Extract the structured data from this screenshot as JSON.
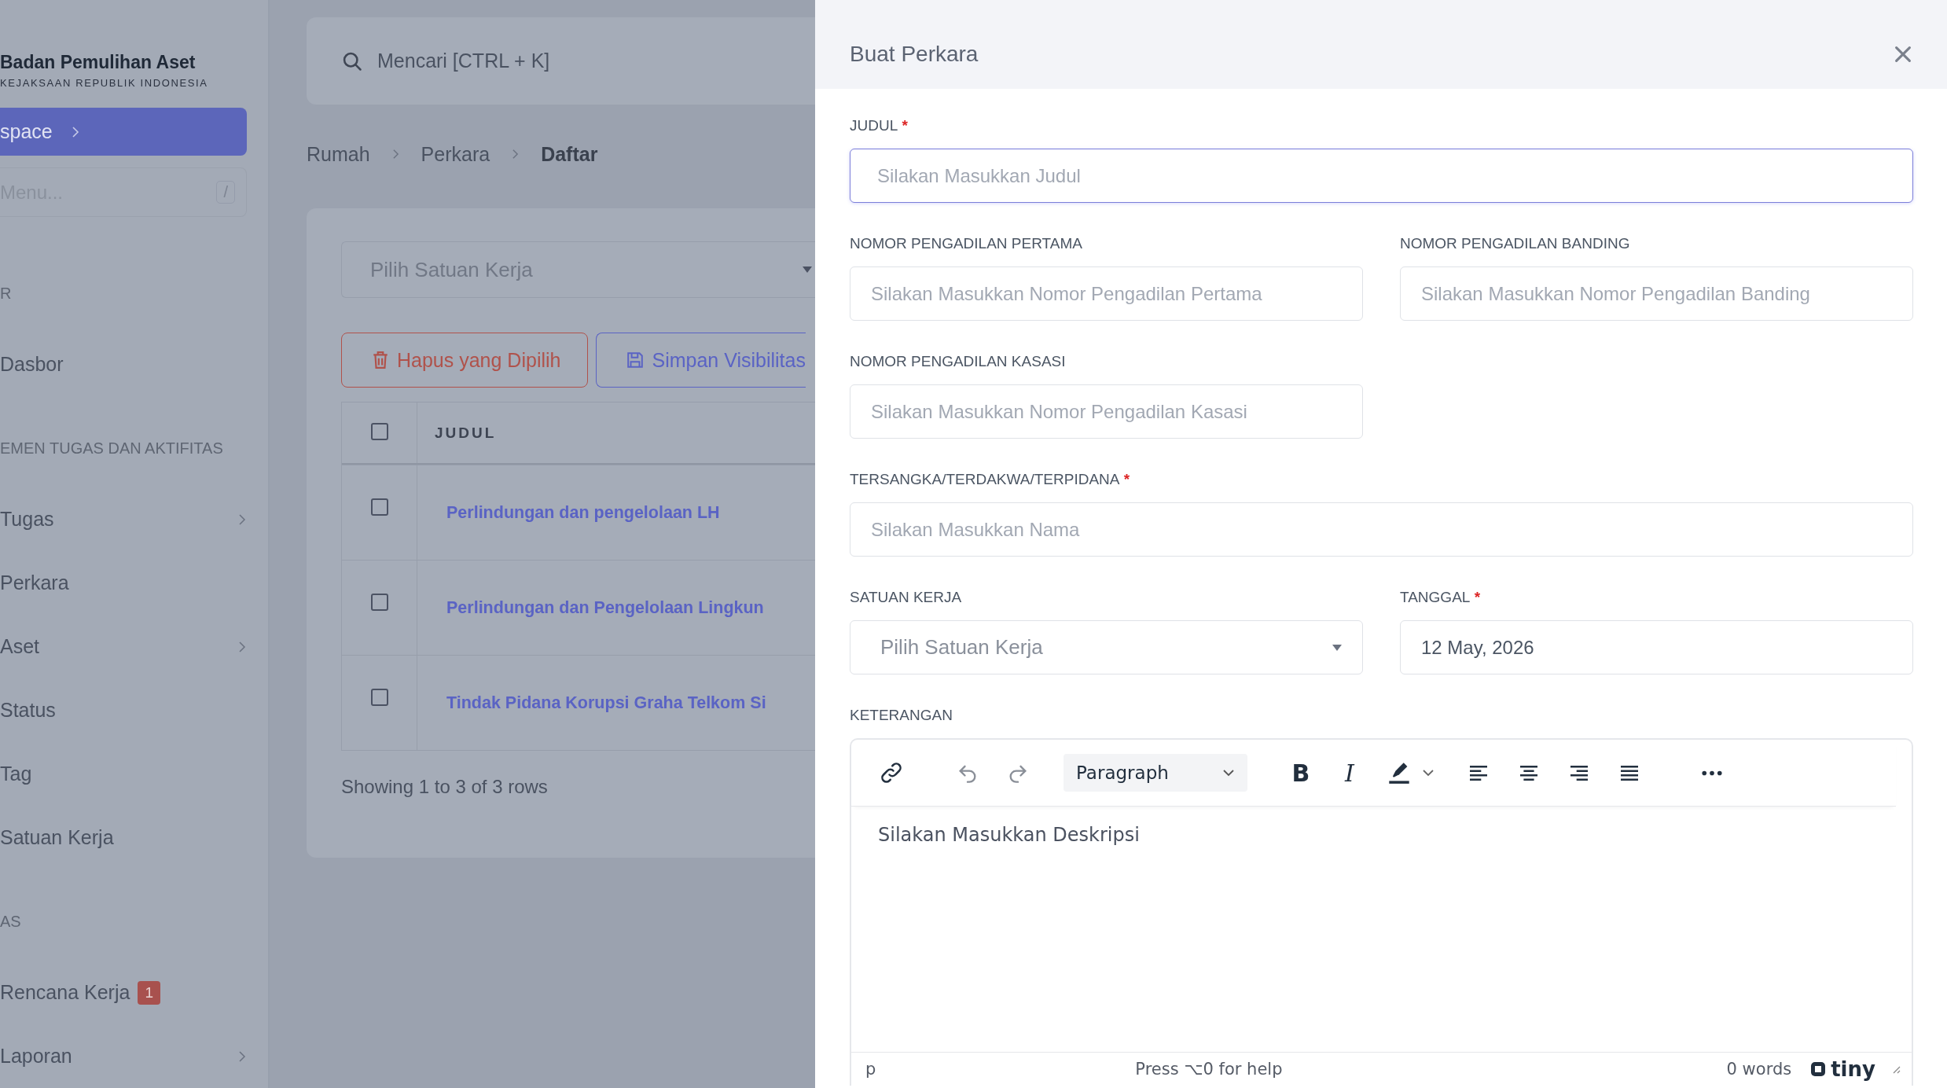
{
  "sidebar": {
    "brand_title": "Badan Pemulihan Aset",
    "brand_subtitle": "KEJAKSAAN REPUBLIK INDONESIA",
    "workspace_button": "space",
    "menu_search": {
      "placeholder": "Menu...",
      "shortcut": "/"
    },
    "sections": [
      {
        "heading": "R",
        "items": [
          {
            "label": "Dasbor",
            "has_submenu": false
          }
        ]
      },
      {
        "heading": "EMEN TUGAS DAN AKTIFITAS",
        "items": [
          {
            "label": "Tugas",
            "has_submenu": true
          },
          {
            "label": "Perkara",
            "has_submenu": false
          },
          {
            "label": "Aset",
            "has_submenu": true
          },
          {
            "label": "Status",
            "has_submenu": false
          },
          {
            "label": "Tag",
            "has_submenu": false
          },
          {
            "label": "Satuan Kerja",
            "has_submenu": false
          }
        ]
      },
      {
        "heading": "AS",
        "items": [
          {
            "label": "Rencana Kerja",
            "has_submenu": false,
            "badge": "1"
          },
          {
            "label": "Laporan",
            "has_submenu": true
          }
        ]
      }
    ]
  },
  "topbar": {
    "search": {
      "placeholder": "Mencari [CTRL + K]"
    }
  },
  "breadcrumb": [
    {
      "label": "Rumah",
      "current": false
    },
    {
      "label": "Perkara",
      "current": false
    },
    {
      "label": "Daftar",
      "current": true
    }
  ],
  "list": {
    "filter": {
      "placeholder": "Pilih Satuan Kerja"
    },
    "actions": [
      {
        "label": "Hapus yang Dipilih",
        "kind": "delete"
      },
      {
        "label": "Simpan Visibilitas",
        "kind": "save"
      }
    ],
    "table": {
      "header_checked": false,
      "columns": [
        "JUDUL"
      ],
      "rows": [
        {
          "title": "Perlindungan dan pengelolaan LH",
          "checked": false
        },
        {
          "title": "Perlindungan dan Pengelolaan Lingkun",
          "checked": false
        },
        {
          "title": "Tindak Pidana Korupsi Graha Telkom Si",
          "checked": false
        }
      ]
    },
    "footer": "Showing 1 to 3 of 3 rows"
  },
  "drawer": {
    "title": "Buat Perkara",
    "rows": [
      [
        {
          "label": "JUDUL",
          "required": true,
          "kind": "text",
          "placeholder": "Silakan Masukkan Judul",
          "focused": true
        }
      ],
      [
        {
          "label": "NOMOR PENGADILAN PERTAMA",
          "required": false,
          "kind": "text",
          "placeholder": "Silakan Masukkan Nomor Pengadilan Pertama",
          "focused": false
        },
        {
          "label": "NOMOR PENGADILAN BANDING",
          "required": false,
          "kind": "text",
          "placeholder": "Silakan Masukkan Nomor Pengadilan Banding",
          "focused": false
        }
      ],
      [
        {
          "label": "NOMOR PENGADILAN KASASI",
          "required": false,
          "kind": "text",
          "placeholder": "Silakan Masukkan Nomor Pengadilan Kasasi",
          "focused": false
        },
        {
          "kind": "empty"
        }
      ],
      [
        {
          "label": "TERSANGKA/TERDAKWA/TERPIDANA",
          "required": true,
          "kind": "text",
          "placeholder": "Silakan Masukkan Nama",
          "focused": false
        }
      ],
      [
        {
          "label": "SATUAN KERJA",
          "required": false,
          "kind": "select",
          "placeholder": "Pilih Satuan Kerja",
          "focused": false
        },
        {
          "label": "TANGGAL",
          "required": true,
          "kind": "date",
          "value": "12 May, 2026",
          "focused": false
        }
      ]
    ],
    "required_mark": "*",
    "editor": {
      "label": "KETERANGAN",
      "block_format": "Paragraph",
      "bold": "B",
      "italic": "I",
      "placeholder": "Silakan Masukkan Deskripsi",
      "path": "p",
      "help": "Press ⌥0 for help",
      "word_count": "0 words",
      "brand": "tiny"
    }
  }
}
